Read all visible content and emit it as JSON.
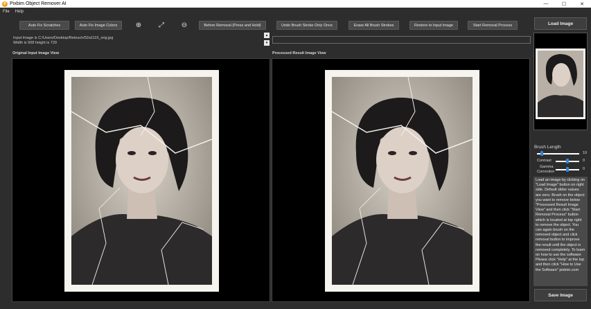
{
  "window": {
    "title": "Pixbim Object Remover AI",
    "icon": "app-logo-icon",
    "controls": {
      "minimize": "—",
      "maximize": "☐",
      "close": "✕"
    }
  },
  "menu": {
    "file": "File",
    "help": "Help"
  },
  "toolbar": {
    "auto_fix_scratches": "Auto Fix Scratches",
    "auto_fix_colors": "Auto Fix Image Colors",
    "zoom_in": "⊕",
    "fit": "⤢",
    "zoom_out": "⊖",
    "before_removal": "Before Removal (Press and Hold)",
    "undo_stroke": "Undo Brush Stroke Only Once",
    "erase_strokes": "Erase All Brush Strokes",
    "restore": "Restore to Input Image",
    "start_removal": "Start Removal Process"
  },
  "info": {
    "path": "Input Image is C:/Users/Desktop/Retouch/52a1119_orig.jpg",
    "size": "Width is 508 height is 729"
  },
  "spinners": {
    "up": "▴",
    "down": "▾"
  },
  "panels": {
    "original_label": "Original Input Image View",
    "result_label": "Processed Result Image View"
  },
  "right_panel": {
    "load_label": "Load Image",
    "save_label": "Save Image",
    "brush_length_label": "Brush Length",
    "brush_length_value": "10",
    "brush_length_level": 0.12,
    "contrast_label": "Contrast",
    "contrast_value": "0",
    "contrast_level": 0.5,
    "gamma_label_1": "Gamma",
    "gamma_label_2": "Correction",
    "gamma_value": "0",
    "gamma_level": 0.5,
    "help_text": "Load an image by clicking on \"Load Image\" button on right side. Default slider values are zero. Brush on the object you want to remove below \"Processed Result Image View\" and then click \"Start Removal Process\" button which is located at top right to remove the object. You can again brush on the removed object and click removal button to improve the result until the object is removed completely. To learn on how to use the software Please click \"Help\" at the top and then click \"How to Use the Software\" pixbim.com"
  },
  "colors": {
    "background": "#2d2d2d",
    "button": "#4a4a4a",
    "slider_thumb": "#2f86d6",
    "view_bg": "#000000"
  }
}
